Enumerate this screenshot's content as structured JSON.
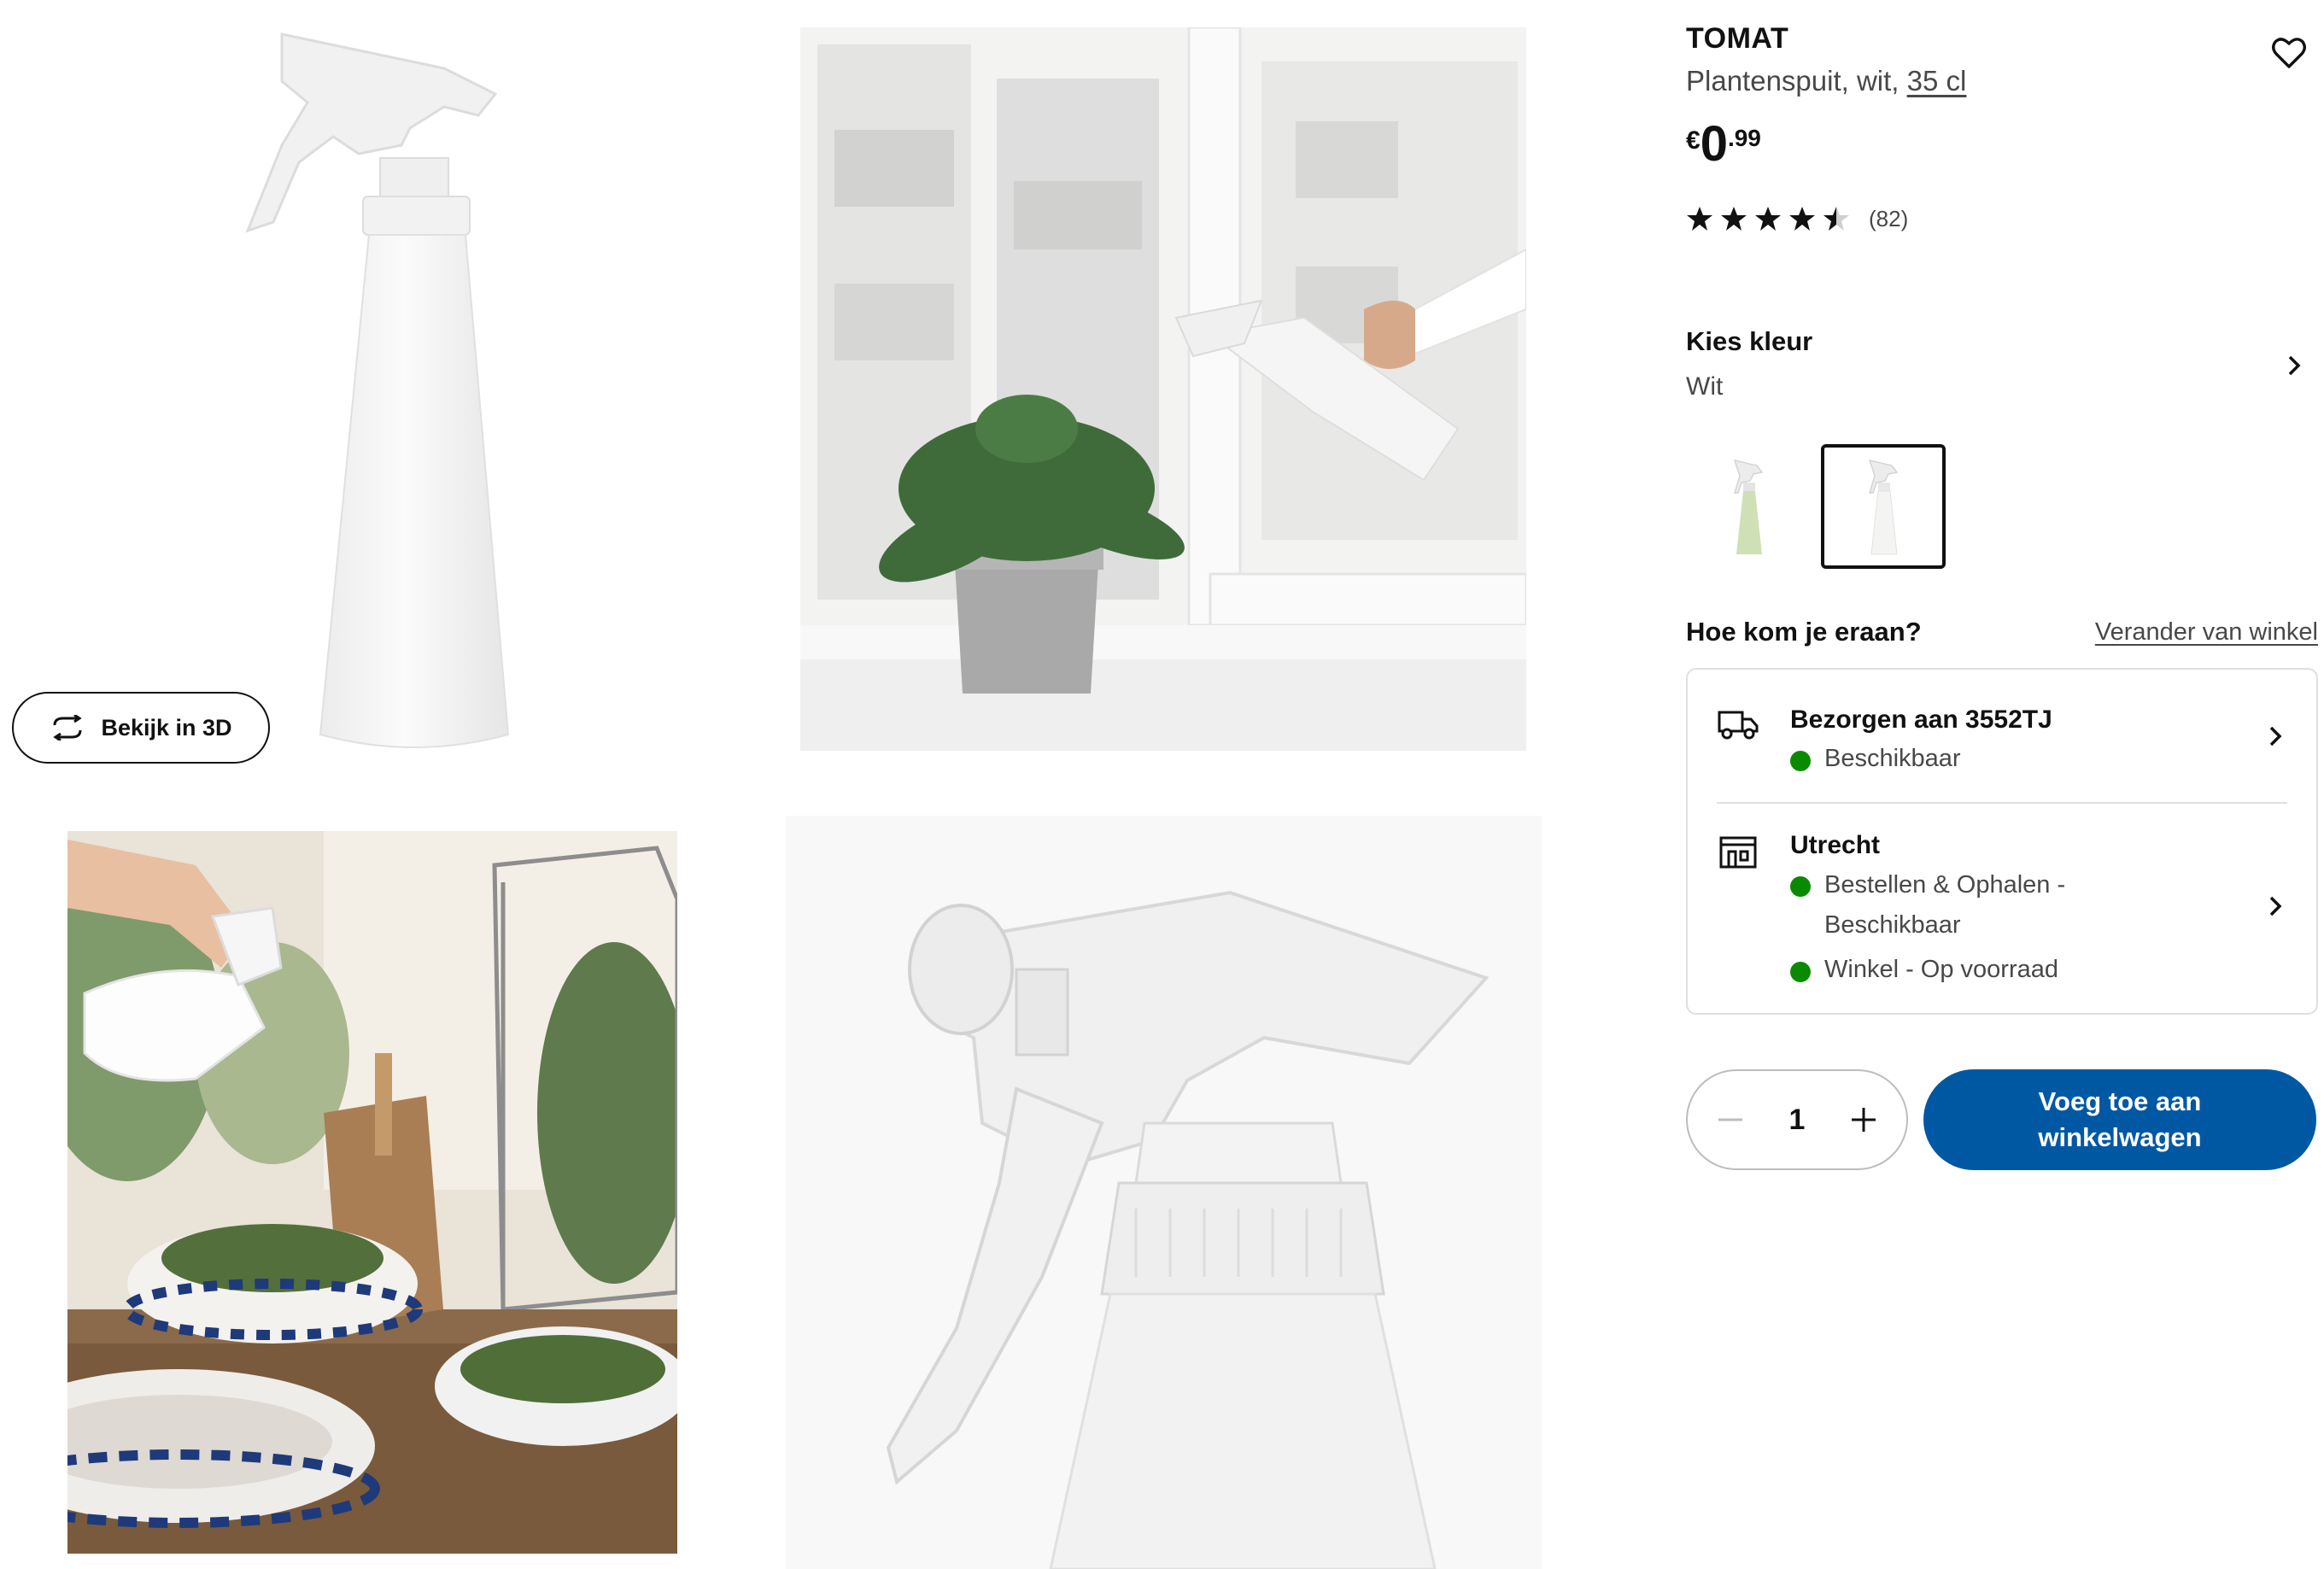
{
  "gallery": {
    "view_3d_label": "Bekijk in 3D",
    "view_3d_icon": "rotate-3d-icon"
  },
  "product": {
    "name": "TOMAT",
    "description": "Plantenspuit, wit, ",
    "size": "35 cl",
    "price": {
      "currency": "€",
      "integer": "0",
      "decimal": ".99"
    },
    "rating": {
      "stars": 4.5,
      "max": 5,
      "count_label": "(82)"
    },
    "wishlist_icon": "heart-icon"
  },
  "colour": {
    "label": "Kies kleur",
    "value": "Wit",
    "options": [
      {
        "name": "light-green",
        "color": "#cfe0b6"
      },
      {
        "name": "white",
        "color": "#f4f4f2",
        "selected": true
      }
    ]
  },
  "availability": {
    "heading": "Hoe kom je eraan?",
    "change_store_link": "Verander van winkel",
    "delivery": {
      "title": "Bezorgen aan 3552TJ",
      "status": "Beschikbaar",
      "icon": "truck-icon"
    },
    "store": {
      "title": "Utrecht",
      "lines": [
        "Bestellen & Ophalen -",
        "Beschikbaar"
      ],
      "stock": "Winkel - Op voorraad",
      "icon": "store-icon"
    },
    "status_color": "#0a8a00"
  },
  "cart": {
    "quantity": "1",
    "add_line1": "Voeg toe aan",
    "add_line2": "winkelwagen",
    "accent": "#0058a3"
  }
}
